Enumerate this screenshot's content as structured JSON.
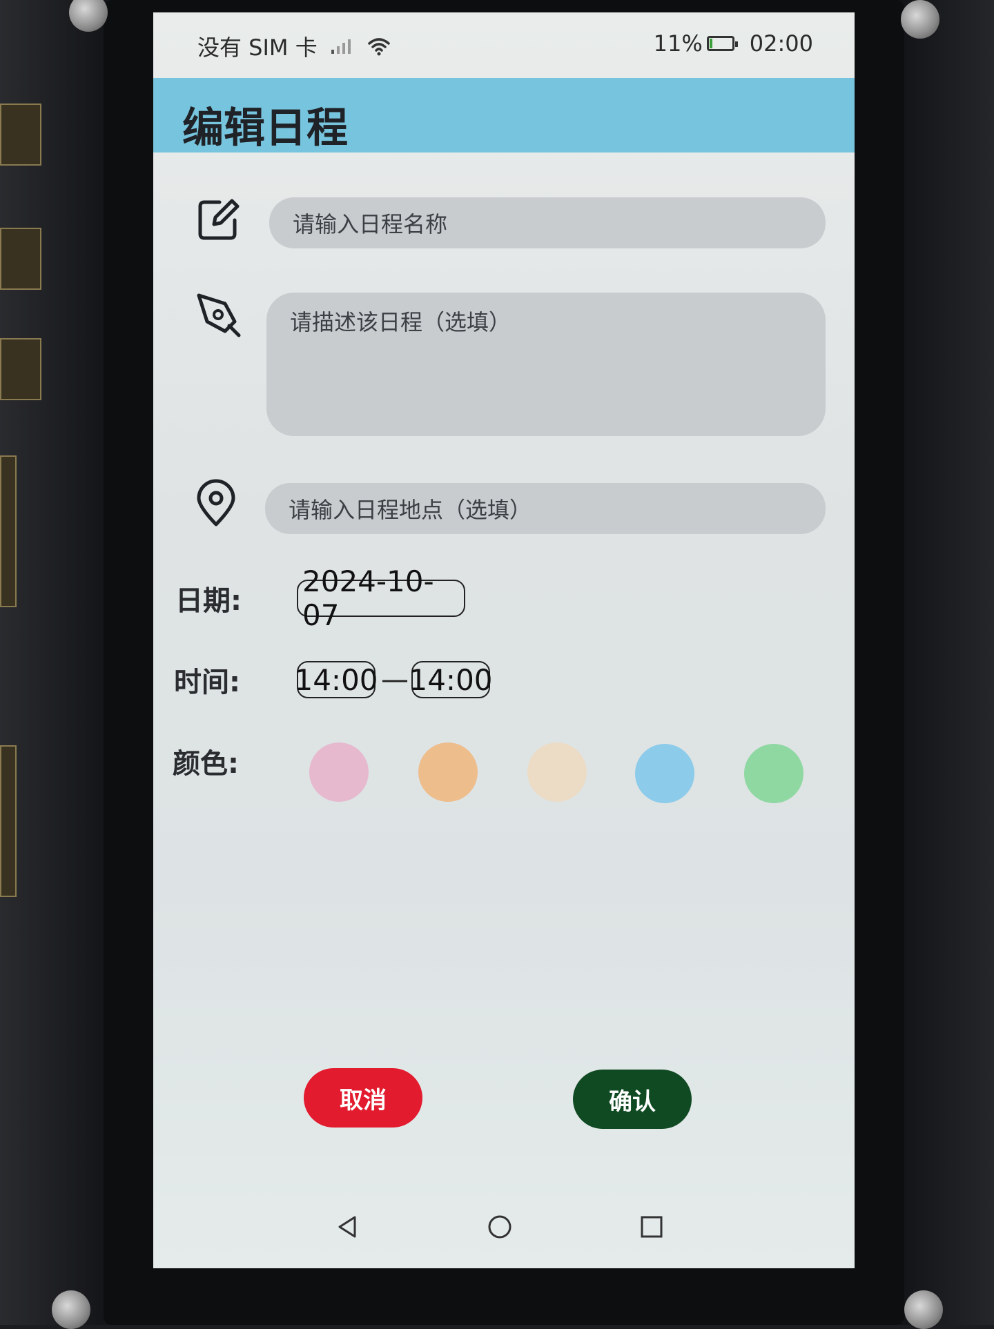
{
  "status": {
    "carrier": "没有 SIM 卡",
    "battery": "11%",
    "battery_level": 0.11,
    "time": "02:00"
  },
  "header": {
    "title": "编辑日程"
  },
  "form": {
    "name_placeholder": "请输入日程名称",
    "desc_placeholder": "请描述该日程（选填）",
    "location_placeholder": "请输入日程地点（选填）",
    "date_label": "日期:",
    "date_value": "2024-10-07",
    "time_label": "时间:",
    "time_start": "14:00",
    "time_separator": "—",
    "time_end": "14:00",
    "color_label": "颜色:",
    "colors": [
      "#e6b9cf",
      "#eebd8c",
      "#ecdcc6",
      "#8ccbea",
      "#8fd8a2"
    ]
  },
  "actions": {
    "cancel_label": "取消",
    "confirm_label": "确认",
    "cancel_color": "#e21b2e",
    "confirm_color": "#0f4a22"
  },
  "nav": {
    "back_icon": "back-triangle-icon",
    "home_icon": "home-circle-icon",
    "recent_icon": "recent-square-icon"
  }
}
